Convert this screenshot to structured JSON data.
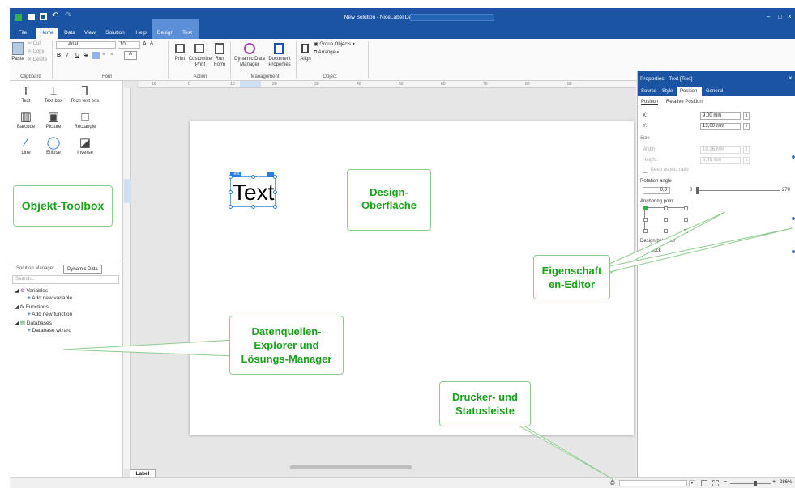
{
  "window": {
    "title": "New Solution - NiceLabel Designer - PowerForms",
    "controls": [
      "–",
      "□",
      "×"
    ]
  },
  "menu": {
    "tabs": [
      "File",
      "Home",
      "Data",
      "View",
      "Solution",
      "Help"
    ],
    "context_tabs": [
      "Design",
      "Text"
    ]
  },
  "ribbon": {
    "clipboard": {
      "paste": "Paste",
      "cut": "Cut",
      "copy": "Copy",
      "delete": "Delete",
      "group": "Clipboard"
    },
    "font": {
      "family": "Arial",
      "size": "10",
      "bold": "B",
      "italic": "I",
      "underline": "U",
      "strike": "S",
      "group": "Font"
    },
    "action": {
      "print": "Print",
      "customize_print": "Customize Print",
      "run_form": "Run Form",
      "group": "Action"
    },
    "management": {
      "dynamic_data": "Dynamic Data Manager",
      "doc_props": "Document Properties",
      "group": "Management"
    },
    "object": {
      "align": "Align",
      "group_objects": "Group Objects",
      "arrange": "Arrange",
      "group": "Object"
    }
  },
  "toolbox": {
    "tools": [
      {
        "label": "Text",
        "glyph": "T"
      },
      {
        "label": "Text box",
        "glyph": "⌶"
      },
      {
        "label": "Rich text box",
        "glyph": "Ꞁ"
      },
      {
        "label": "Barcode",
        "glyph": "▥"
      },
      {
        "label": "Picture",
        "glyph": "▣"
      },
      {
        "label": "Rectangle",
        "glyph": "□"
      },
      {
        "label": "Line",
        "glyph": "⁄"
      },
      {
        "label": "Ellipse",
        "glyph": "◯"
      },
      {
        "label": "Inverse",
        "glyph": "◪"
      }
    ]
  },
  "explorer": {
    "tabs": [
      "Solution Manager",
      "Dynamic Data"
    ],
    "search_placeholder": "Search...",
    "tree": [
      {
        "label": "Variables",
        "child": "Add new variable"
      },
      {
        "label": "Functions",
        "child": "Add new function"
      },
      {
        "label": "Databases",
        "child": "Database wizard"
      }
    ]
  },
  "ruler": {
    "marks": [
      "10",
      "0",
      "10",
      "20",
      "30",
      "40",
      "50",
      "60",
      "70",
      "80",
      "90"
    ]
  },
  "canvas": {
    "text_object": {
      "value": "Text",
      "tag": "Text"
    },
    "label_tab": "Label"
  },
  "properties": {
    "title": "Properties - Text [Text]",
    "tabs": [
      "Source",
      "Style",
      "Position",
      "General"
    ],
    "subtabs": [
      "Position",
      "Relative Position"
    ],
    "x_label": "X:",
    "x_value": "9,00 mm",
    "y_label": "Y:",
    "y_value": "13,00 mm",
    "size_section": "Size",
    "width_label": "Width:",
    "width_value": "10,26 mm",
    "height_label": "Height:",
    "height_value": "6,01 mm",
    "keep_ratio": "Keep aspect ratio",
    "rotation_section": "Rotation angle",
    "rotation_value": "0,0",
    "rotation_min": "0",
    "rotation_max": "270",
    "anchoring_section": "Anchoring point",
    "design_section": "Design behavior",
    "lock_label": "Lock"
  },
  "status": {
    "zoom": "286%"
  },
  "callouts": {
    "toolbox": "Objekt-Toolbox",
    "design_1": "Design-",
    "design_2": "Oberfläche",
    "props_1": "Eigenschaft",
    "props_2": "en-Editor",
    "data_1": "Datenquellen-",
    "data_2": "Explorer und",
    "data_3": "Lösungs-Manager",
    "printer_1": "Drucker- und",
    "printer_2": "Statusleiste"
  },
  "colors": {
    "titlebar": "#1b54a3",
    "context_tab": "#5b8fd8",
    "callout_text": "#1aa21a",
    "callout_border": "#8ecb8e"
  }
}
